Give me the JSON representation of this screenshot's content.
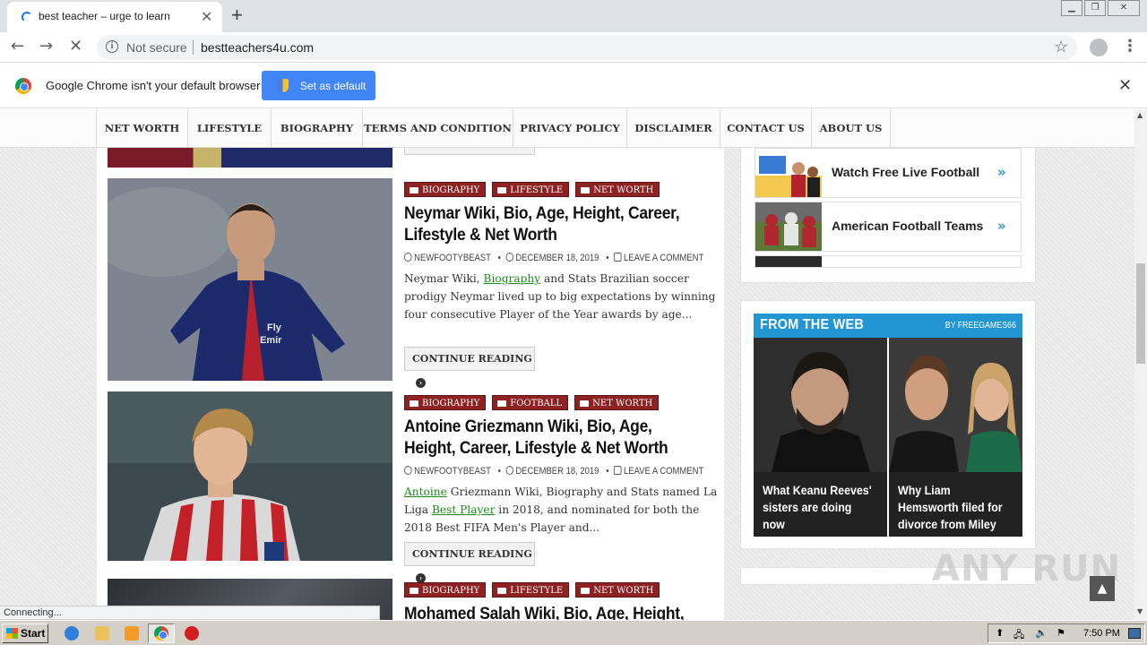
{
  "browser": {
    "tab_title": "best teacher – urge to learn",
    "tab_close": "✕",
    "new_tab": "+",
    "security_label": "Not secure",
    "url": "bestteachers4u.com",
    "infobar_text": "Google Chrome isn't your default browser",
    "set_default_label": "Set as default",
    "infobar_close": "✕",
    "status_text": "Connecting..."
  },
  "nav": {
    "items": [
      "NET WORTH",
      "LIFESTYLE",
      "BIOGRAPHY",
      "TERMS AND CONDITION",
      "PRIVACY POLICY",
      "DISCLAIMER",
      "CONTACT US",
      "ABOUT US"
    ]
  },
  "posts": [
    {
      "categories": [
        "BIOGRAPHY",
        "LIFESTYLE",
        "NET WORTH"
      ],
      "title": "Neymar Wiki, Bio, Age, Height, Career, Lifestyle & Net Worth",
      "author": "NEWFOOTYBEAST",
      "date": "DECEMBER 18, 2019",
      "comments": "LEAVE A COMMENT",
      "excerpt_a": "Neymar Wiki, ",
      "excerpt_link": "Biography",
      "excerpt_b": " and Stats Brazilian soccer prodigy Neymar lived up to big expectations by winning four consecutive Player of the Year awards by age...",
      "continue": "CONTINUE READING"
    },
    {
      "categories": [
        "BIOGRAPHY",
        "FOOTBALL",
        "NET WORTH"
      ],
      "title": "Antoine Griezmann Wiki, Bio, Age, Height, Career, Lifestyle & Net Worth",
      "author": "NEWFOOTYBEAST",
      "date": "DECEMBER 18, 2019",
      "comments": "LEAVE A COMMENT",
      "excerpt_link1": "Antoine",
      "excerpt_a": " Griezmann Wiki, Biography and Stats  named La Liga ",
      "excerpt_link2": "Best Player",
      "excerpt_b": " in 2018, and nominated for both the 2018 Best FIFA Men's Player and...",
      "continue": "CONTINUE READING"
    },
    {
      "categories": [
        "BIOGRAPHY",
        "LIFESTYLE",
        "NET WORTH"
      ],
      "title": "Mohamed Salah Wiki, Bio, Age, Height,"
    }
  ],
  "sidebar": {
    "links": [
      "Watch Free Live Football",
      "American Football Teams"
    ],
    "from_the_web": "FROM THE WEB",
    "by_line": "BY FREEGAMES66",
    "cards": [
      "What Keanu Reeves' sisters are doing now",
      "Why Liam Hemsworth filed for divorce from Miley Cyrus"
    ]
  },
  "watermark": "ANY RUN",
  "taskbar": {
    "start_label": "Start",
    "clock": "7:50 PM"
  }
}
